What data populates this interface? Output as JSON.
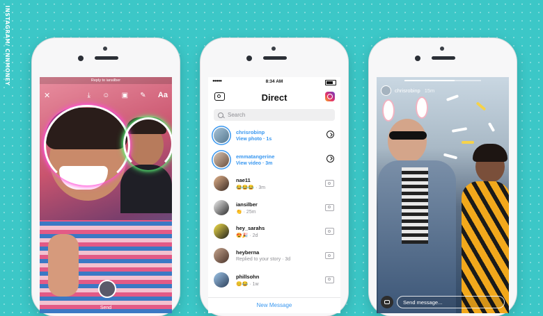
{
  "credit": "INSTAGRAM/ CNNMONEY",
  "phone1": {
    "reply_label": "Reply to iansilber",
    "close_glyph": "✕",
    "text_tool_label": "Aa",
    "send_label": "Send"
  },
  "phone2": {
    "status_time": "8:34 AM",
    "signal": "●●●●● ",
    "title": "Direct",
    "search_placeholder": "Search",
    "threads": [
      {
        "name": "chrisrobinp",
        "status": "View photo · 1s",
        "unread": true
      },
      {
        "name": "emmatangerine",
        "status": "View video · 3m",
        "unread": true
      },
      {
        "name": "nae11",
        "status": "😂😂😂 · 3m",
        "unread": false
      },
      {
        "name": "iansilber",
        "status": "👏 · 25m",
        "unread": false
      },
      {
        "name": "hey_sarahs",
        "status": "😍🎉 · 2d",
        "unread": false
      },
      {
        "name": "heyberna",
        "status": "Replied to your story · 3d",
        "unread": false
      },
      {
        "name": "phillsohn",
        "status": "😊😂 · 1w",
        "unread": false
      }
    ],
    "new_message_label": "New Message"
  },
  "phone3": {
    "username": "chrisrobinp",
    "time": "15m",
    "progress": 0.65,
    "message_placeholder": "Send message..."
  },
  "colors": {
    "background": "#3cc7c7",
    "instagram_blue": "#3897f0"
  }
}
